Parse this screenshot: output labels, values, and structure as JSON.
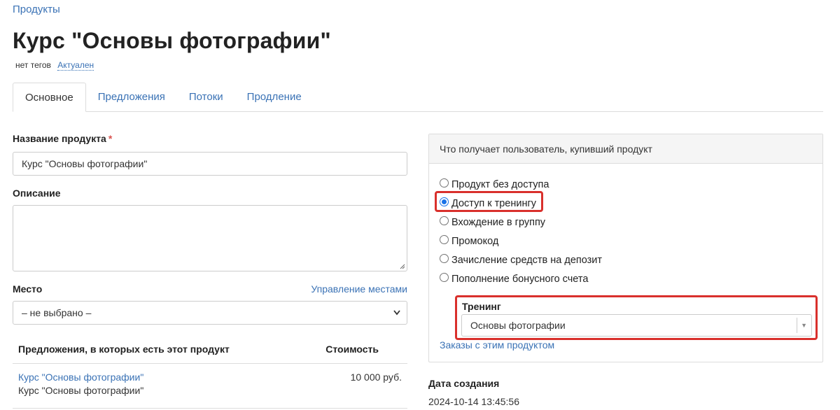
{
  "breadcrumb": "Продукты",
  "title": "Курс \"Основы фотографии\"",
  "tags": {
    "text": "нет тегов",
    "status": "Актуален"
  },
  "tabs": [
    {
      "label": "Основное",
      "active": true
    },
    {
      "label": "Предложения",
      "active": false
    },
    {
      "label": "Потоки",
      "active": false
    },
    {
      "label": "Продление",
      "active": false
    }
  ],
  "form": {
    "name_label": "Название продукта",
    "name_required": "*",
    "name_value": "Курс \"Основы фотографии\"",
    "description_label": "Описание",
    "description_value": "",
    "place_label": "Место",
    "place_manage_link": "Управление местами",
    "place_value": "– не выбрано –"
  },
  "offers": {
    "col_name": "Предложения, в которых есть этот продукт",
    "col_price": "Стоимость",
    "rows": [
      {
        "link": "Курс \"Основы фотографии\"",
        "sub": "Курс \"Основы фотографии\"",
        "price": "10 000 руб."
      }
    ]
  },
  "access_panel": {
    "header": "Что получает пользователь, купивший продукт",
    "options": [
      {
        "label": "Продукт без доступа",
        "checked": false
      },
      {
        "label": "Доступ к тренингу",
        "checked": true
      },
      {
        "label": "Вхождение в группу",
        "checked": false
      },
      {
        "label": "Промокод",
        "checked": false
      },
      {
        "label": "Зачисление средств на депозит",
        "checked": false
      },
      {
        "label": "Пополнение бонусного счета",
        "checked": false
      }
    ],
    "training_label": "Тренинг",
    "training_value": "Основы фотографии",
    "orders_link": "Заказы с этим продуктом"
  },
  "created": {
    "label": "Дата создания",
    "value": "2024-10-14 13:45:56"
  },
  "colors": {
    "link": "#3a72b5",
    "highlight": "#d9302c",
    "radio_checked": "#1a73e8"
  }
}
